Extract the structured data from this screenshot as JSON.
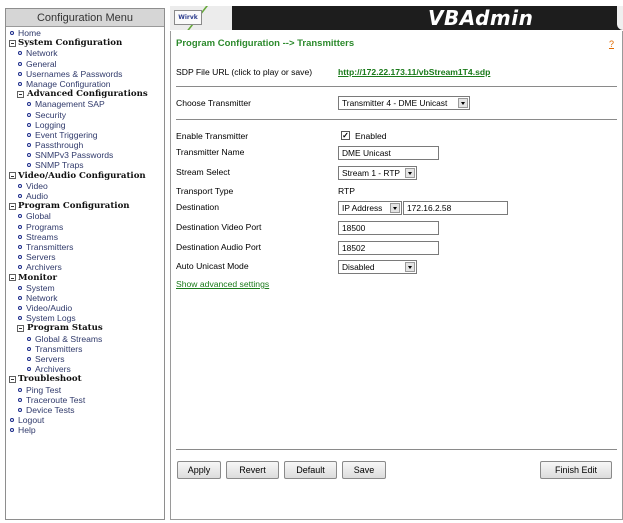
{
  "sidebar": {
    "title": "Configuration Menu",
    "items": [
      {
        "label": "Home",
        "level": 0,
        "kind": "bullet"
      },
      {
        "label": "System Configuration",
        "level": 0,
        "kind": "box",
        "bold": true
      },
      {
        "label": "Network",
        "level": 1,
        "kind": "bullet"
      },
      {
        "label": "General",
        "level": 1,
        "kind": "bullet"
      },
      {
        "label": "Usernames & Passwords",
        "level": 1,
        "kind": "bullet"
      },
      {
        "label": "Manage Configuration",
        "level": 1,
        "kind": "bullet"
      },
      {
        "label": "Advanced Configurations",
        "level": 1,
        "kind": "box",
        "bold": true
      },
      {
        "label": "Management SAP",
        "level": 2,
        "kind": "bullet"
      },
      {
        "label": "Security",
        "level": 2,
        "kind": "bullet"
      },
      {
        "label": "Logging",
        "level": 2,
        "kind": "bullet"
      },
      {
        "label": "Event Triggering",
        "level": 2,
        "kind": "bullet"
      },
      {
        "label": "Passthrough",
        "level": 2,
        "kind": "bullet"
      },
      {
        "label": "SNMPv3 Passwords",
        "level": 2,
        "kind": "bullet"
      },
      {
        "label": "SNMP Traps",
        "level": 2,
        "kind": "bullet"
      },
      {
        "label": "Video/Audio Configuration",
        "level": 0,
        "kind": "box",
        "bold": true
      },
      {
        "label": "Video",
        "level": 1,
        "kind": "bullet"
      },
      {
        "label": "Audio",
        "level": 1,
        "kind": "bullet"
      },
      {
        "label": "Program Configuration",
        "level": 0,
        "kind": "box",
        "bold": true
      },
      {
        "label": "Global",
        "level": 1,
        "kind": "bullet"
      },
      {
        "label": "Programs",
        "level": 1,
        "kind": "bullet"
      },
      {
        "label": "Streams",
        "level": 1,
        "kind": "bullet"
      },
      {
        "label": "Transmitters",
        "level": 1,
        "kind": "bullet"
      },
      {
        "label": "Servers",
        "level": 1,
        "kind": "bullet"
      },
      {
        "label": "Archivers",
        "level": 1,
        "kind": "bullet"
      },
      {
        "label": "Monitor",
        "level": 0,
        "kind": "box",
        "bold": true
      },
      {
        "label": "System",
        "level": 1,
        "kind": "bullet"
      },
      {
        "label": "Network",
        "level": 1,
        "kind": "bullet"
      },
      {
        "label": "Video/Audio",
        "level": 1,
        "kind": "bullet"
      },
      {
        "label": "System Logs",
        "level": 1,
        "kind": "bullet"
      },
      {
        "label": "Program Status",
        "level": 1,
        "kind": "box",
        "bold": true
      },
      {
        "label": "Global & Streams",
        "level": 2,
        "kind": "bullet"
      },
      {
        "label": "Transmitters",
        "level": 2,
        "kind": "bullet"
      },
      {
        "label": "Servers",
        "level": 2,
        "kind": "bullet"
      },
      {
        "label": "Archivers",
        "level": 2,
        "kind": "bullet"
      },
      {
        "label": "Troubleshoot",
        "level": 0,
        "kind": "box",
        "bold": true
      },
      {
        "label": "Ping Test",
        "level": 1,
        "kind": "bullet"
      },
      {
        "label": "Traceroute Test",
        "level": 1,
        "kind": "bullet"
      },
      {
        "label": "Device Tests",
        "level": 1,
        "kind": "bullet"
      },
      {
        "label": "Logout",
        "level": 0,
        "kind": "bullet"
      },
      {
        "label": "Help",
        "level": 0,
        "kind": "bullet"
      }
    ]
  },
  "banner": {
    "logo_text": "Wirvk",
    "title": "VBAdmin"
  },
  "page": {
    "heading": "Program Configuration --> Transmitters",
    "help_link": "?",
    "sdp_label": "SDP File URL (click to play or save)",
    "sdp_url": "http://172.22.173.11/vbStream1T4.sdp",
    "choose_label": "Choose Transmitter",
    "choose_value": "Transmitter 4 - DME Unicast",
    "enable_label": "Enable Transmitter",
    "enable_checked": true,
    "enable_value_label": "Enabled",
    "name_label": "Transmitter Name",
    "name_value": "DME Unicast",
    "stream_label": "Stream Select",
    "stream_value": "Stream 1 - RTP",
    "transport_label": "Transport Type",
    "transport_value": "RTP",
    "destination_label": "Destination",
    "destination_type": "IP Address",
    "destination_ip": "172.16.2.58",
    "video_port_label": "Destination Video Port",
    "video_port_value": "18500",
    "audio_port_label": "Destination Audio Port",
    "audio_port_value": "18502",
    "unicast_label": "Auto Unicast Mode",
    "unicast_value": "Disabled",
    "advanced_link": "Show advanced settings"
  },
  "buttons": {
    "apply": "Apply",
    "revert": "Revert",
    "default": "Default",
    "save": "Save",
    "finish": "Finish Edit"
  },
  "colors": {
    "heading_green": "#2c8a2c",
    "link_green": "#1a7a1a",
    "banner_bg": "#1d1d1d",
    "menu_text": "#303a6b"
  }
}
